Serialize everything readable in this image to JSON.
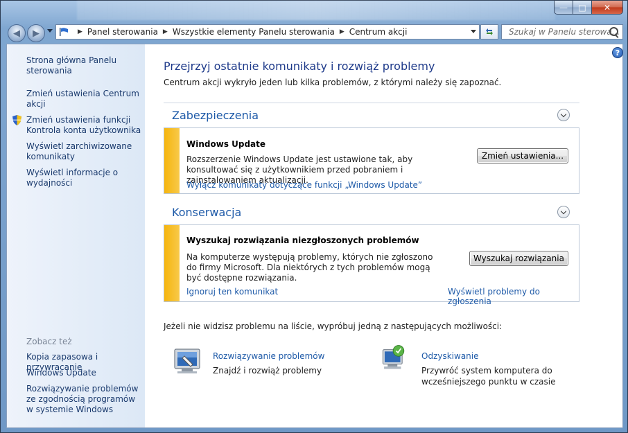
{
  "window": {
    "min_glyph": "—",
    "max_glyph": "□",
    "close_glyph": "✕"
  },
  "nav": {
    "back_glyph": "◀",
    "forward_glyph": "▶",
    "breadcrumb": [
      "Panel sterowania",
      "Wszystkie elementy Panelu sterowania",
      "Centrum akcji"
    ],
    "search_placeholder": "Szukaj w Panelu sterowa..."
  },
  "sidebar": {
    "links": [
      "Strona główna Panelu sterowania",
      "Zmień ustawienia Centrum akcji",
      "Zmień ustawienia funkcji Kontrola konta użytkownika",
      "Wyświetl zarchiwizowane komunikaty",
      "Wyświetl informacje o wydajności"
    ],
    "see_also_label": "Zobacz też",
    "see_also": [
      "Kopia zapasowa i przywracanie",
      "Windows Update",
      "Rozwiązywanie problemów ze zgodnością programów w systemie Windows"
    ]
  },
  "main": {
    "help_glyph": "?",
    "title": "Przejrzyj ostatnie komunikaty i rozwiąż problemy",
    "subtitle": "Centrum akcji wykryło jeden lub kilka problemów, z którymi należy się zapoznać.",
    "security": {
      "title": "Zabezpieczenia",
      "msg_title": "Windows Update",
      "msg_text": "Rozszerzenie Windows Update jest ustawione tak, aby konsultować się z użytkownikiem przed pobraniem i zainstalowaniem aktualizacji.",
      "button": "Zmień ustawienia...",
      "link": "Wyłącz komunikaty dotyczące funkcji „Windows Update”"
    },
    "maintenance": {
      "title": "Konserwacja",
      "msg_title": "Wyszukaj rozwiązania niezgłoszonych problemów",
      "msg_text": "Na komputerze występują problemy, których nie zgłoszono do firmy Microsoft. Dla niektórych z tych problemów mogą być dostępne rozwiązania.",
      "button": "Wyszukaj rozwiązania",
      "link_ignore": "Ignoruj ten komunikat",
      "link_view": "Wyświetl problemy do zgłoszenia"
    },
    "hint": "Jeżeli nie widzisz problemu na liście, wypróbuj jedną z następujących możliwości:",
    "options": [
      {
        "title": "Rozwiązywanie problemów",
        "desc": "Znajdź i rozwiąż problemy",
        "icon": "troubleshoot-icon"
      },
      {
        "title": "Odzyskiwanie",
        "desc": "Przywróć system komputera do wcześniejszego punktu w czasie",
        "icon": "recovery-icon"
      }
    ]
  },
  "colors": {
    "accent_link": "#1e5aa8",
    "warning_bar": "#f5b50e",
    "heading": "#1e3a8a"
  }
}
